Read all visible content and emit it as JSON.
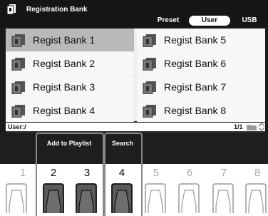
{
  "header": {
    "title": "Registration Bank",
    "tabs": [
      {
        "label": "Preset",
        "active": false
      },
      {
        "label": "User",
        "active": true
      },
      {
        "label": "USB",
        "active": false
      }
    ]
  },
  "banks": [
    {
      "label": "Regist Bank 1",
      "selected": true
    },
    {
      "label": "Regist Bank 2",
      "selected": false
    },
    {
      "label": "Regist Bank 3",
      "selected": false
    },
    {
      "label": "Regist Bank 4",
      "selected": false
    },
    {
      "label": "Regist Bank 5",
      "selected": false
    },
    {
      "label": "Regist Bank 6",
      "selected": false
    },
    {
      "label": "Regist Bank 7",
      "selected": false
    },
    {
      "label": "Regist Bank 8",
      "selected": false
    }
  ],
  "status": {
    "path": "User:/",
    "page": "1/1"
  },
  "functions": {
    "add_to_playlist": "Add to Playlist",
    "search": "Search"
  },
  "buttons": [
    {
      "number": "1",
      "active": false
    },
    {
      "number": "2",
      "active": true
    },
    {
      "number": "3",
      "active": true
    },
    {
      "number": "4",
      "active": true
    },
    {
      "number": "5",
      "active": false
    },
    {
      "number": "6",
      "active": false
    },
    {
      "number": "7",
      "active": false
    },
    {
      "number": "8",
      "active": false
    }
  ],
  "colors": {
    "screen_bg": "#1a1a1a",
    "selected_cell": "#b9b9b9",
    "cell_bg": "#f7f7f7",
    "active_pad": "#5a5a5a"
  }
}
